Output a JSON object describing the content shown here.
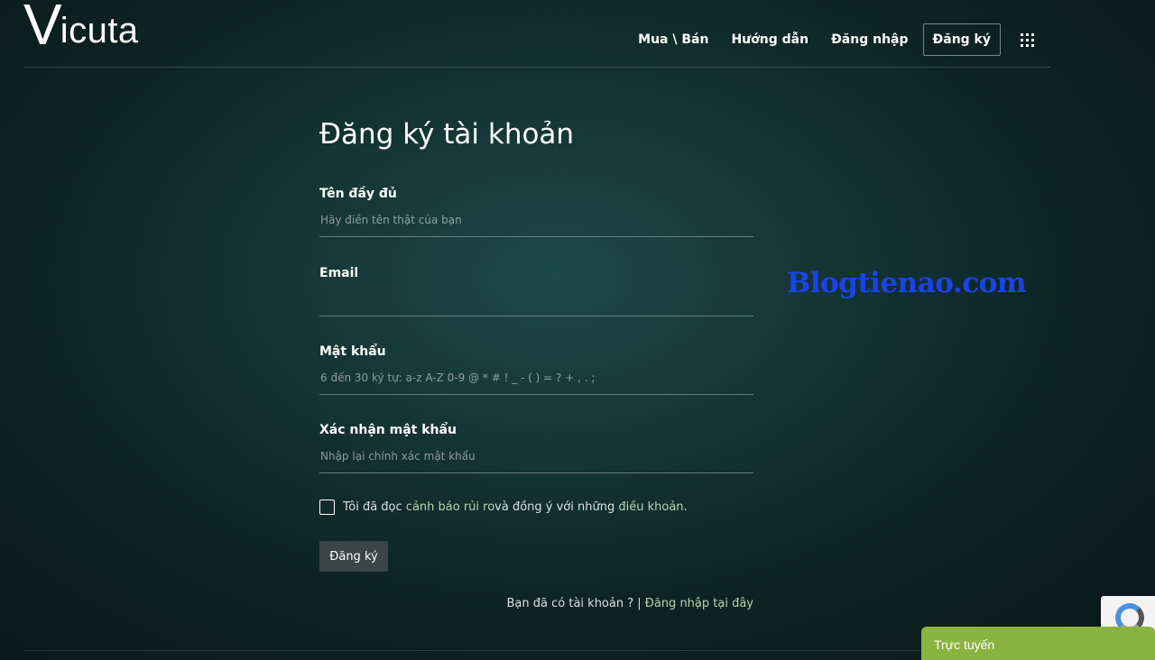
{
  "brand": {
    "logo_v": "V",
    "logo_rest": "icuta"
  },
  "nav": {
    "items": [
      {
        "label": "Mua \\ Bán"
      },
      {
        "label": "Hướng dẫn"
      },
      {
        "label": "Đăng nhập"
      },
      {
        "label": "Đăng ký"
      }
    ],
    "apps_icon": "grid-icon"
  },
  "form": {
    "title": "Đăng ký tài khoản",
    "fields": [
      {
        "label": "Tên đầy đủ",
        "value": "",
        "placeholder": "Hãy điền tên thật của bạn"
      },
      {
        "label": "Email",
        "value": "",
        "placeholder": ""
      },
      {
        "label": "Mật khẩu",
        "value": "",
        "placeholder": "6 đến 30 ký tự: a-z A-Z 0-9 @ * # ! _ - ( ) = ? + , . ;"
      },
      {
        "label": "Xác nhận mật khẩu",
        "value": "",
        "placeholder": "Nhập lại chính xác mật khẩu"
      }
    ],
    "terms": {
      "checked": false,
      "prefix": "Tôi đã đọc ",
      "link1": "cảnh báo rủi ro",
      "middle": " và đồng ý với những ",
      "link2": "điều khoản",
      "suffix": "."
    },
    "submit_label": "Đăng ký",
    "have_account_text": "Bạn đã có tài khoản ? | ",
    "login_link": "Đăng nhập tại đây"
  },
  "watermark": "Blogtienao.com",
  "chat_widget": {
    "label": "Trực tuyến",
    "color": "#8ab440"
  },
  "colors": {
    "accent_link": "#b9d2b0",
    "watermark": "#1a44e8"
  }
}
